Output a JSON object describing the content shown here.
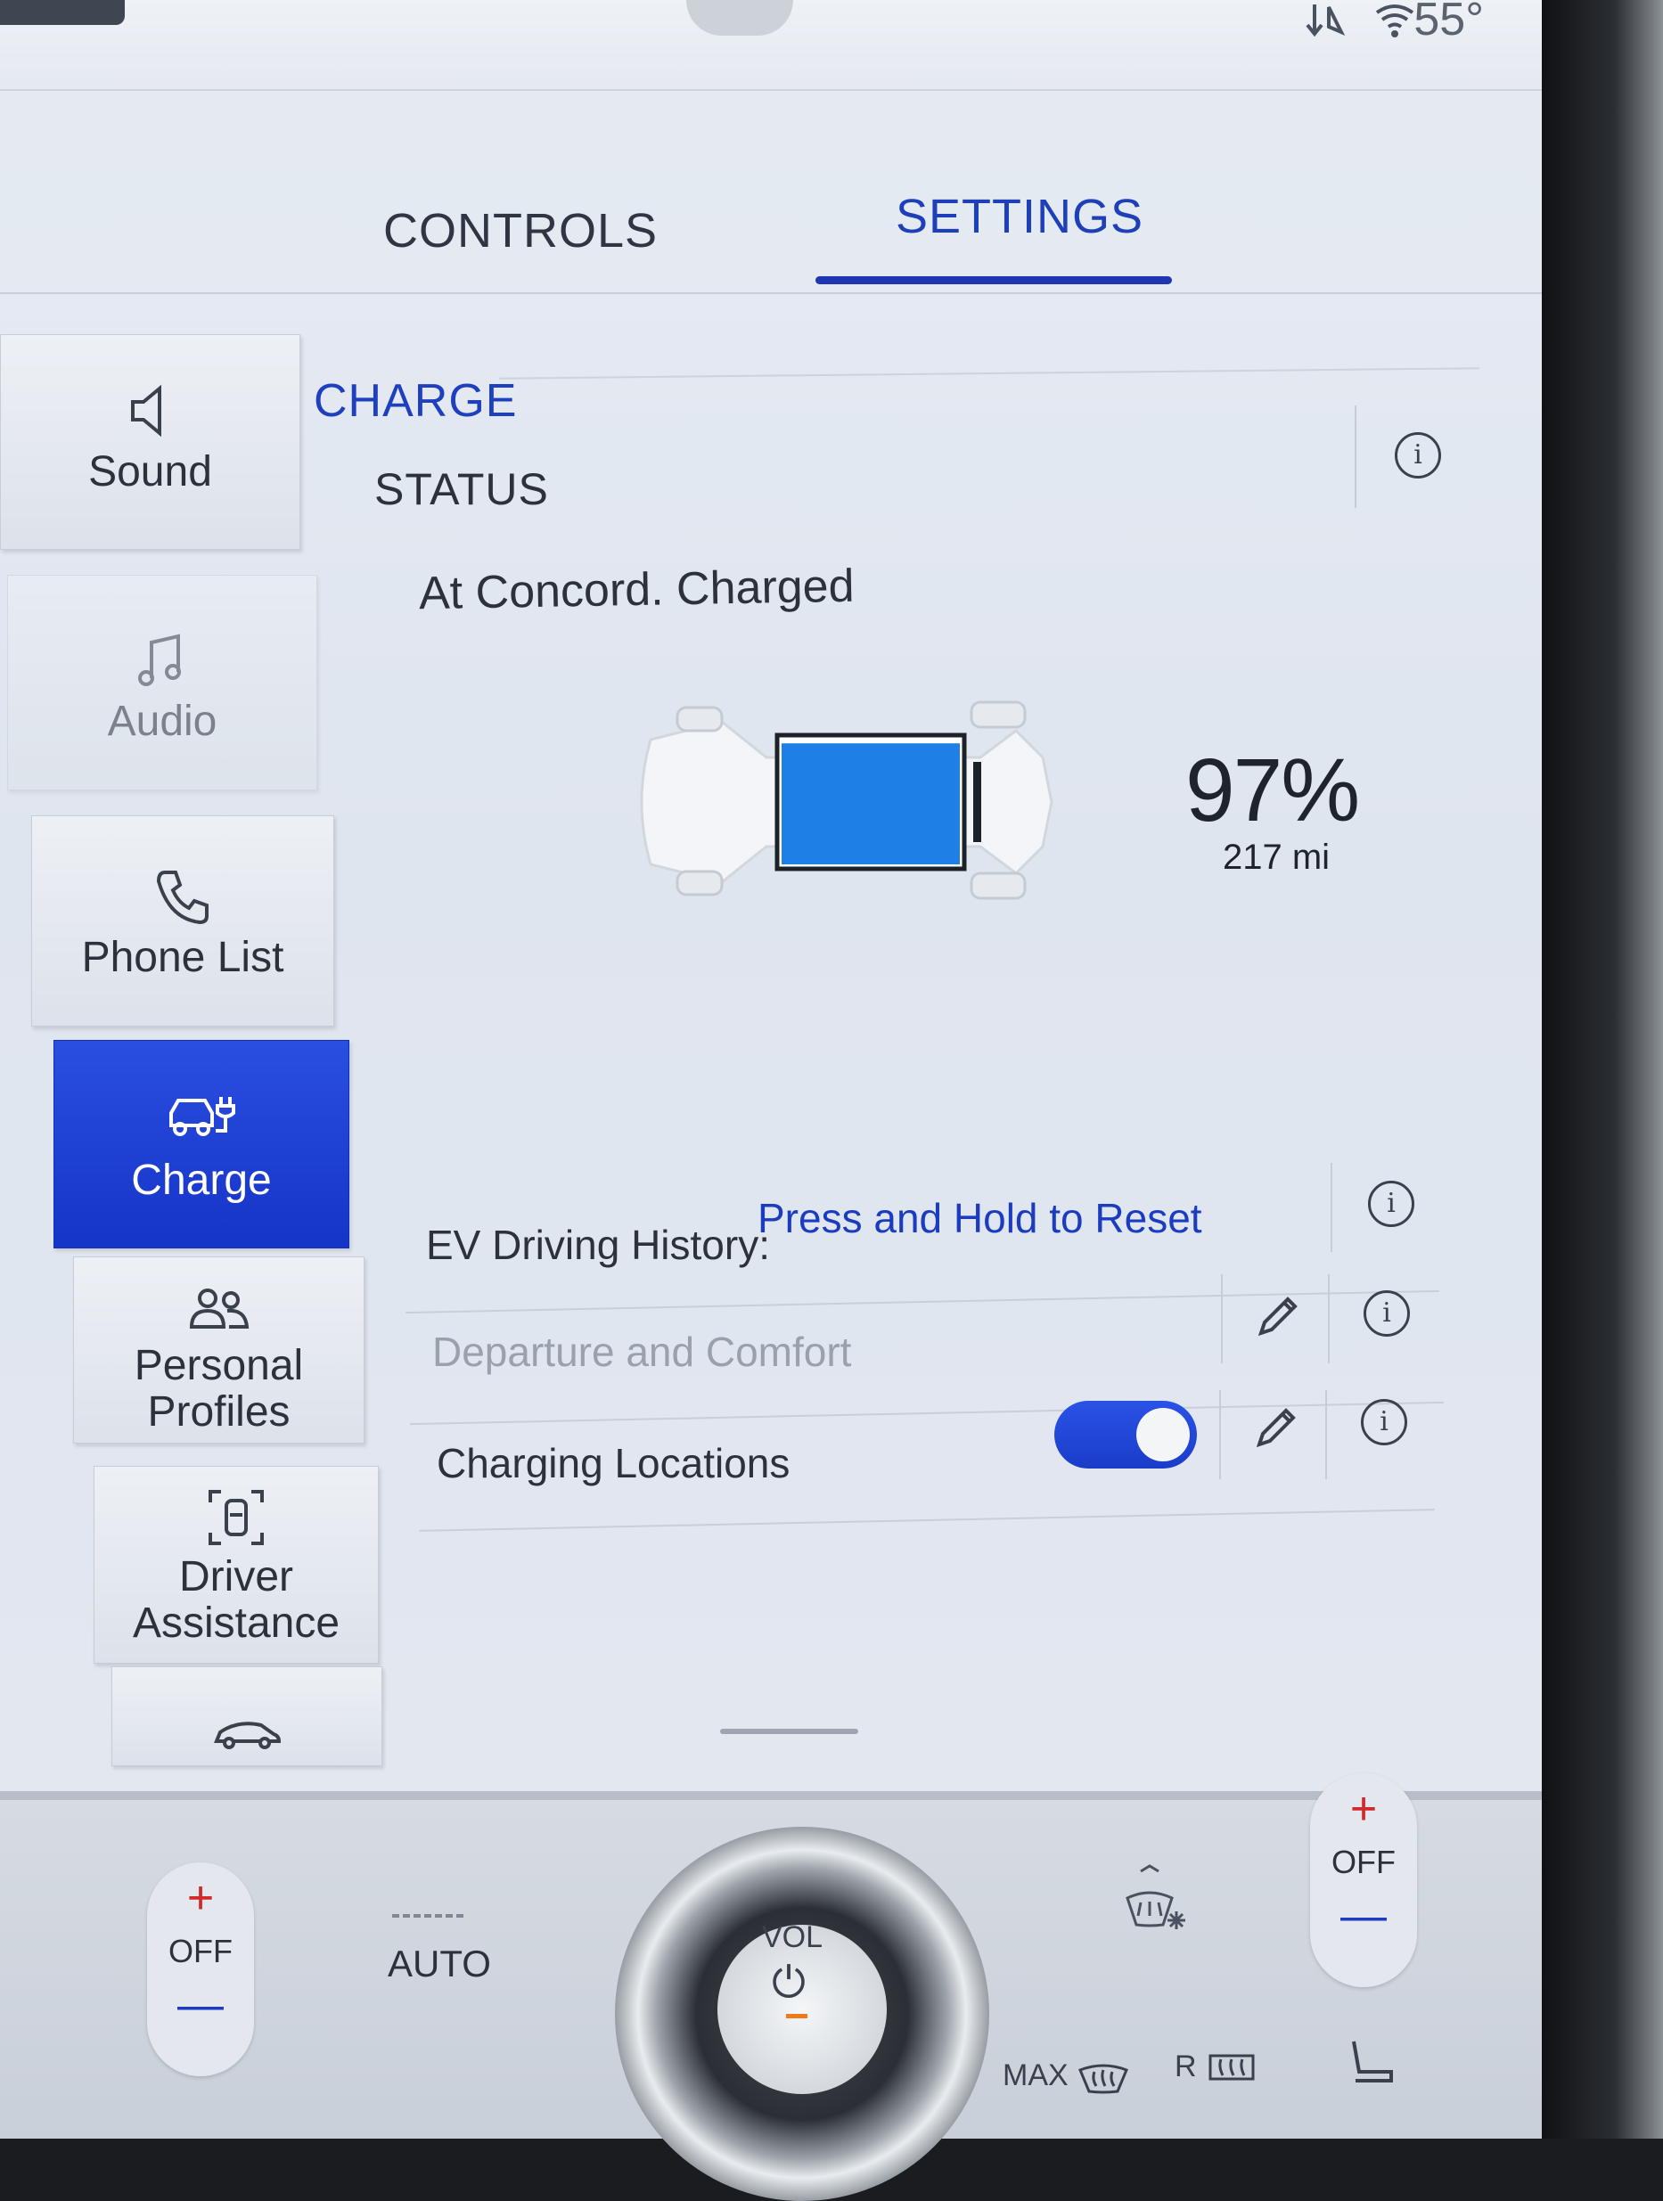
{
  "status_bar": {
    "temperature": "55°",
    "icons": [
      "nav-signal-icon",
      "wifi-icon"
    ]
  },
  "tabs": [
    {
      "label": "CONTROLS",
      "active": false
    },
    {
      "label": "SETTINGS",
      "active": true
    }
  ],
  "sidebar": {
    "items": [
      {
        "label": "Sound",
        "icon": "speaker-icon",
        "state": "normal"
      },
      {
        "label": "Audio",
        "icon": "music-note-icon",
        "state": "disabled"
      },
      {
        "label": "Phone List",
        "icon": "phone-icon",
        "state": "normal"
      },
      {
        "label": "Charge",
        "icon": "ev-charge-icon",
        "state": "selected"
      },
      {
        "label_line1": "Personal",
        "label_line2": "Profiles",
        "icon": "people-icon",
        "state": "normal"
      },
      {
        "label_line1": "Driver",
        "label_line2": "Assistance",
        "icon": "driver-assist-icon",
        "state": "normal"
      },
      {
        "icon": "car-icon",
        "state": "partial"
      }
    ]
  },
  "charge": {
    "section_title": "CHARGE",
    "status_title": "STATUS",
    "status_text": "At Concord. Charged",
    "battery_percent_text": "97%",
    "battery_level": 0.97,
    "range_text": "217 mi",
    "battery_fill_color": "#1e7fe6"
  },
  "settings_rows": {
    "ev_history_label": "EV Driving History:",
    "ev_history_action": "Press and Hold to Reset",
    "departure_label": "Departure and Comfort",
    "charging_locations_label": "Charging Locations",
    "charging_locations_enabled": true
  },
  "climate": {
    "left_temp": {
      "plus": "+",
      "value": "OFF",
      "minus": "—"
    },
    "auto_label": "AUTO",
    "volume_label": "VOL",
    "power_symbol": "⏻",
    "max_defrost_label": "MAX",
    "rear_defrost_label": "R",
    "right_temp": {
      "plus": "+",
      "value": "OFF",
      "minus": "—"
    }
  },
  "colors": {
    "accent": "#1e3fbe",
    "selected_tab_underline": "#1e36b0",
    "toggle_on": "#2a52e6",
    "temp_up": "#d12a2a"
  }
}
